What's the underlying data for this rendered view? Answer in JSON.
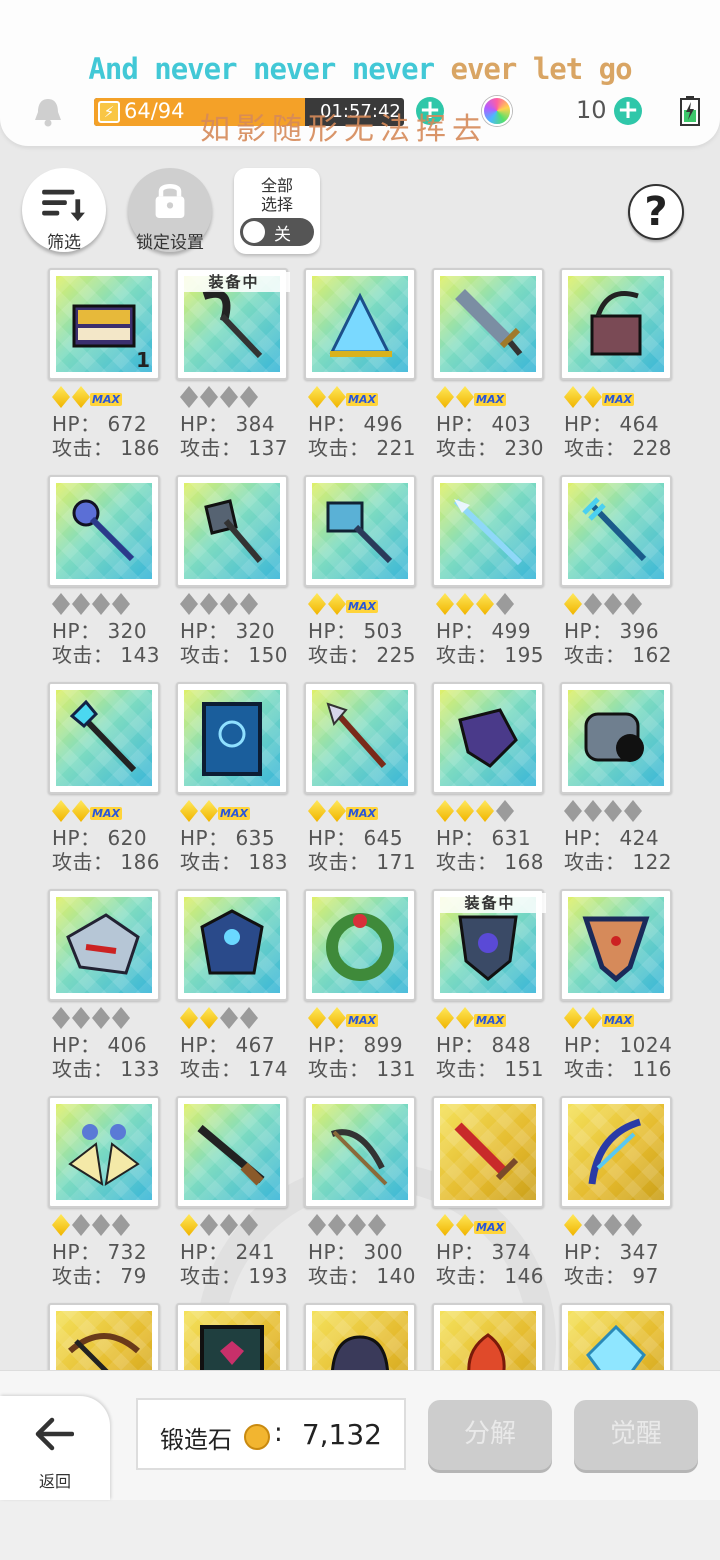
{
  "status_bar": {
    "lyric_en_a": "And never never never ",
    "lyric_en_b": "ever let go",
    "lyric_zh": "如影随形无法挥去",
    "energy": "64/94",
    "energy_fraction": 0.68,
    "timer": "01:57:42",
    "gem_count": "10"
  },
  "controls": {
    "filter_label": "筛选",
    "lock_label": "锁定设置",
    "select_all_line1": "全部",
    "select_all_line2": "选择",
    "toggle_state": "关"
  },
  "equipped_label": "装备中",
  "hp_prefix": "HP：",
  "atk_prefix": "攻击：",
  "max_label": "MAX",
  "items": [
    {
      "icon": "chest-icon",
      "stars": 2,
      "max": true,
      "hp": "672",
      "atk": "186",
      "stack": "1"
    },
    {
      "icon": "scythe-icon",
      "stars": 0,
      "max": false,
      "hp": "384",
      "atk": "137",
      "equipped": true
    },
    {
      "icon": "ice-fan-icon",
      "stars": 2,
      "max": true,
      "hp": "496",
      "atk": "221"
    },
    {
      "icon": "broadsword-icon",
      "stars": 2,
      "max": true,
      "hp": "403",
      "atk": "230"
    },
    {
      "icon": "bag-icon",
      "stars": 2,
      "max": true,
      "hp": "464",
      "atk": "228"
    },
    {
      "icon": "scepter-icon",
      "stars": 0,
      "max": false,
      "hp": "320",
      "atk": "143"
    },
    {
      "icon": "axe-icon",
      "stars": 0,
      "max": false,
      "hp": "320",
      "atk": "150"
    },
    {
      "icon": "hammer-icon",
      "stars": 2,
      "max": true,
      "hp": "503",
      "atk": "225"
    },
    {
      "icon": "spear-icon",
      "stars": 3,
      "max": false,
      "hp": "499",
      "atk": "195"
    },
    {
      "icon": "trident-icon",
      "stars": 1,
      "max": false,
      "hp": "396",
      "atk": "162"
    },
    {
      "icon": "staff-icon",
      "stars": 2,
      "max": true,
      "hp": "620",
      "atk": "186"
    },
    {
      "icon": "book-icon",
      "stars": 2,
      "max": true,
      "hp": "635",
      "atk": "183"
    },
    {
      "icon": "lance-icon",
      "stars": 2,
      "max": true,
      "hp": "645",
      "atk": "171"
    },
    {
      "icon": "gauntlet-icon",
      "stars": 3,
      "max": false,
      "hp": "631",
      "atk": "168"
    },
    {
      "icon": "cannon-icon",
      "stars": 0,
      "max": false,
      "hp": "424",
      "atk": "122"
    },
    {
      "icon": "shark-icon",
      "stars": 0,
      "max": false,
      "hp": "406",
      "atk": "133"
    },
    {
      "icon": "armor-icon",
      "stars": 2,
      "max": false,
      "hp": "467",
      "atk": "174"
    },
    {
      "icon": "wreath-icon",
      "stars": 2,
      "max": true,
      "hp": "899",
      "atk": "131"
    },
    {
      "icon": "round-shield-icon",
      "stars": 2,
      "max": true,
      "hp": "848",
      "atk": "151",
      "equipped": true
    },
    {
      "icon": "shield-icon",
      "stars": 2,
      "max": true,
      "hp": "1024",
      "atk": "116"
    },
    {
      "icon": "wings-icon",
      "stars": 1,
      "max": false,
      "hp": "732",
      "atk": "79"
    },
    {
      "icon": "rifle-icon",
      "stars": 1,
      "max": false,
      "hp": "241",
      "atk": "193"
    },
    {
      "icon": "bow-icon",
      "stars": 0,
      "max": false,
      "hp": "300",
      "atk": "140"
    },
    {
      "icon": "red-sword-icon",
      "stars": 2,
      "max": true,
      "hp": "374",
      "atk": "146",
      "gold": true
    },
    {
      "icon": "dragon-bow-icon",
      "stars": 1,
      "max": false,
      "hp": "347",
      "atk": "97",
      "gold": true
    },
    {
      "icon": "crossbow-icon",
      "gold": true,
      "partial": true
    },
    {
      "icon": "tome-icon",
      "gold": true,
      "partial": true
    },
    {
      "icon": "helmet-icon",
      "gold": true,
      "partial": true
    },
    {
      "icon": "flame-icon",
      "gold": true,
      "partial": true
    },
    {
      "icon": "crystal-icon",
      "gold": true,
      "partial": true
    }
  ],
  "bottom": {
    "back_label": "返回",
    "stone_label": "锻造石",
    "stone_colon": ":",
    "stone_value": "7,132",
    "decompose_label": "分解",
    "awaken_label": "觉醒"
  }
}
